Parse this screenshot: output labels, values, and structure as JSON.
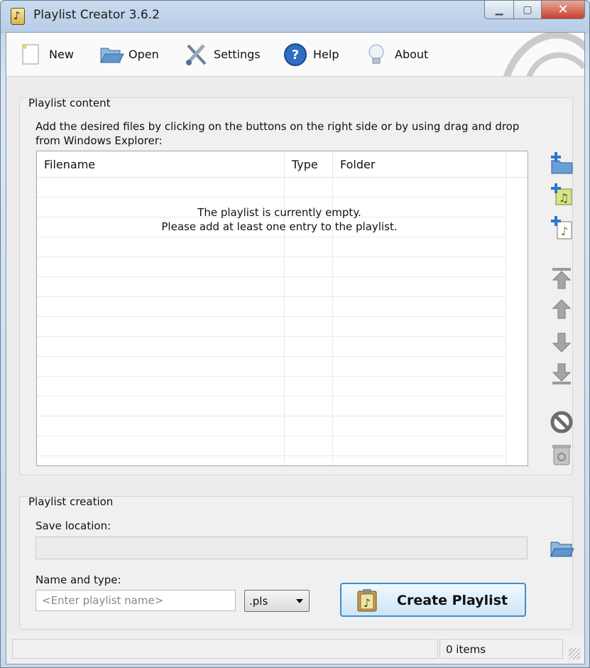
{
  "window": {
    "title": "Playlist Creator 3.6.2",
    "buttons": {
      "minimize": "▁",
      "maximize": "▢",
      "close": "✕"
    }
  },
  "toolbar": {
    "items": [
      {
        "label": "New",
        "icon": "new-document-icon"
      },
      {
        "label": "Open",
        "icon": "open-folder-icon"
      },
      {
        "label": "Settings",
        "icon": "wrench-screwdriver-icon"
      },
      {
        "label": "Help",
        "icon": "help-icon"
      },
      {
        "label": "About",
        "icon": "lightbulb-icon"
      }
    ]
  },
  "content_group": {
    "title": "Playlist content",
    "hint": "Add the desired files by clicking on the buttons on the right side or by using drag and drop from Windows Explorer:",
    "columns": [
      "Filename",
      "Type",
      "Folder"
    ],
    "empty_line1": "The playlist is currently empty.",
    "empty_line2": "Please add at least one entry to the playlist.",
    "side_buttons": [
      "add-folder-icon",
      "add-audio-files-icon",
      "add-playlist-icon",
      "move-to-top-icon",
      "move-up-icon",
      "move-down-icon",
      "move-to-bottom-icon",
      "remove-icon",
      "clear-all-icon"
    ]
  },
  "creation_group": {
    "title": "Playlist creation",
    "save_location_label": "Save location:",
    "save_location_value": "",
    "name_type_label": "Name and type:",
    "name_placeholder": "<Enter playlist name>",
    "type_selected": ".pls",
    "create_label": "Create Playlist"
  },
  "status": {
    "count": "0 items"
  },
  "colors": {
    "accent": "#3d8fcd",
    "window_frame": "#b7cde6",
    "client_bg": "#ececec"
  }
}
